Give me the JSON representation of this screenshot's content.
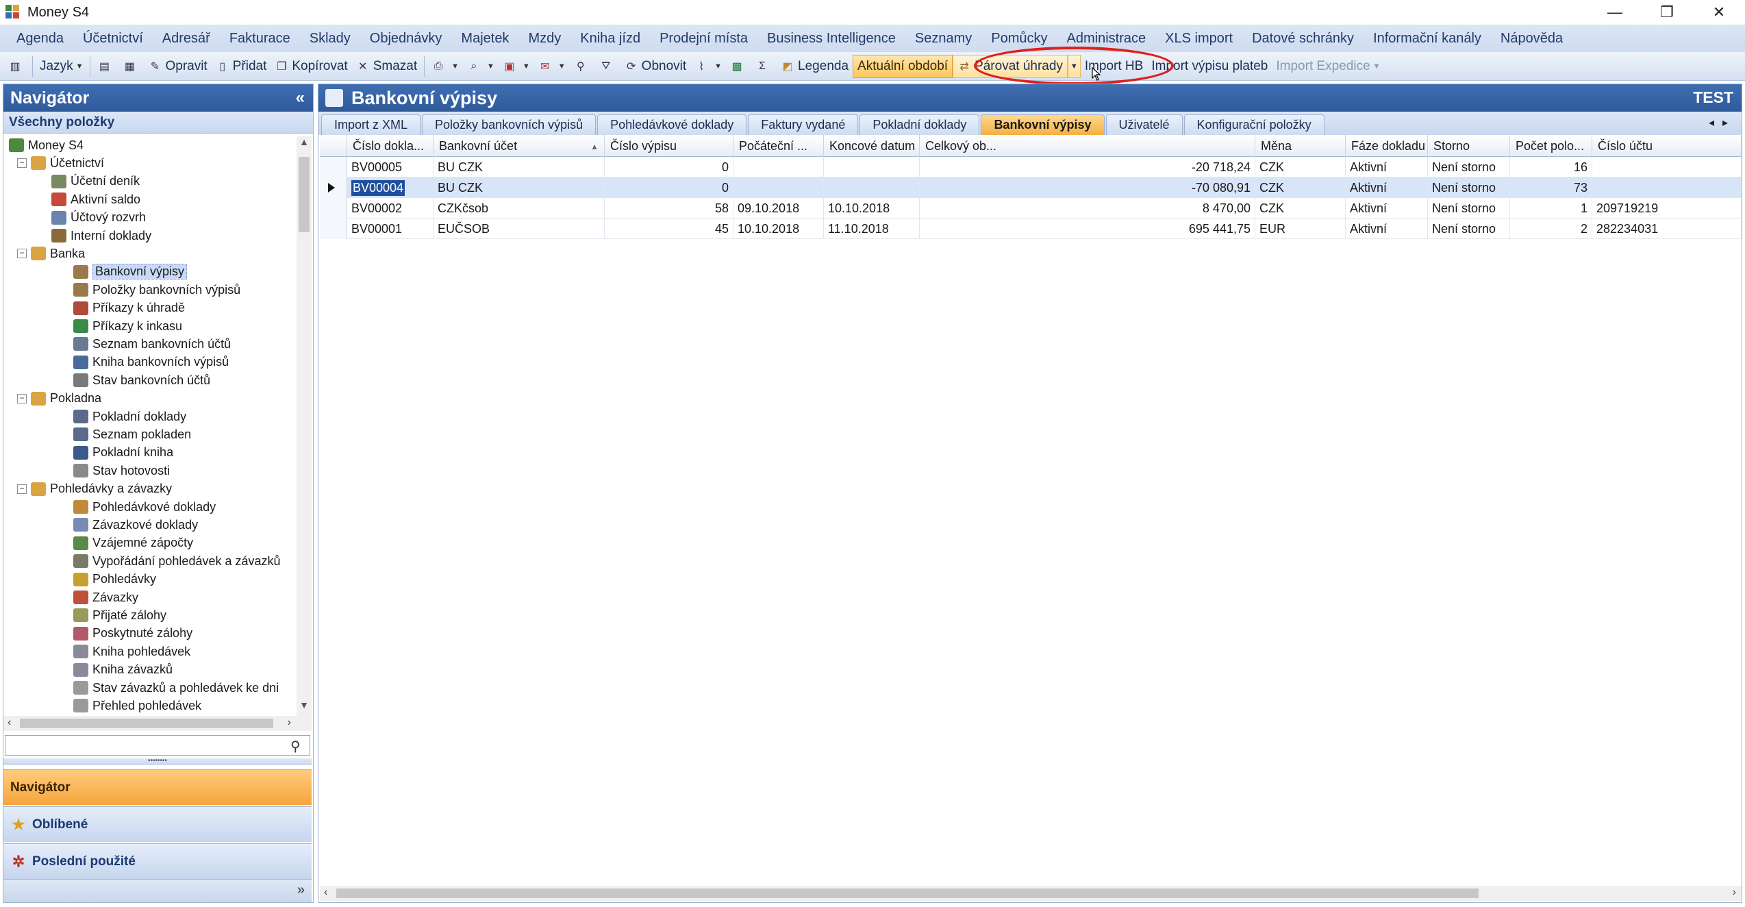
{
  "window": {
    "title": "Money S4",
    "controls": [
      "—",
      "❐",
      "✕"
    ]
  },
  "menu": [
    "Agenda",
    "Účetnictví",
    "Adresář",
    "Fakturace",
    "Sklady",
    "Objednávky",
    "Majetek",
    "Mzdy",
    "Kniha jízd",
    "Prodejní místa",
    "Business Intelligence",
    "Seznamy",
    "Pomůcky",
    "Administrace",
    "XLS import",
    "Datové schránky",
    "Informační kanály",
    "Nápověda"
  ],
  "toolbar": {
    "jazyk": "Jazyk",
    "opravit": "Opravit",
    "pridat": "Přidat",
    "kopirovat": "Kopírovat",
    "smazat": "Smazat",
    "obnovit": "Obnovit",
    "sigma": "Σ",
    "legenda": "Legenda",
    "aktualni_obdobi": "Aktuální období",
    "parovat_uhrady": "Párovat úhrady",
    "import_hb": "Import HB",
    "import_vypisu": "Import výpisu plateb",
    "import_expedice": "Import Expedice"
  },
  "navigator": {
    "title": "Navigátor",
    "collapse": "«",
    "section": "Všechny položky",
    "tree": [
      {
        "label": "Money S4",
        "level": 0,
        "icon": "#4a8a3a"
      },
      {
        "label": "Účetnictví",
        "level": 1,
        "toggle": "⊟",
        "icon": "#d9a441"
      },
      {
        "label": "Účetní deník",
        "level": 2,
        "icon": "#7a8a60"
      },
      {
        "label": "Aktivní saldo",
        "level": 2,
        "icon": "#c44a3a"
      },
      {
        "label": "Účtový rozvrh",
        "level": 2,
        "icon": "#6a84b0"
      },
      {
        "label": "Interní doklady",
        "level": 2,
        "icon": "#8a6a3a"
      },
      {
        "label": "Banka",
        "level": 1,
        "toggle": "⊟",
        "icon": "#d9a441"
      },
      {
        "label": "Bankovní výpisy",
        "level": 3,
        "icon": "#9a7a4a",
        "selected": true
      },
      {
        "label": "Položky bankovních výpisů",
        "level": 3,
        "icon": "#9a7a4a"
      },
      {
        "label": "Příkazy k úhradě",
        "level": 3,
        "icon": "#b04a3a"
      },
      {
        "label": "Příkazy k inkasu",
        "level": 3,
        "icon": "#3a8a4a"
      },
      {
        "label": "Seznam bankovních účtů",
        "level": 3,
        "icon": "#6a7a90"
      },
      {
        "label": "Kniha bankovních výpisů",
        "level": 3,
        "icon": "#4a6a9a"
      },
      {
        "label": "Stav bankovních účtů",
        "level": 3,
        "icon": "#7a7a7a"
      },
      {
        "label": "Pokladna",
        "level": 1,
        "toggle": "⊟",
        "icon": "#d9a441"
      },
      {
        "label": "Pokladní doklady",
        "level": 3,
        "icon": "#5a6a8a"
      },
      {
        "label": "Seznam pokladen",
        "level": 3,
        "icon": "#5a6a8a"
      },
      {
        "label": "Pokladní kniha",
        "level": 3,
        "icon": "#3a5a8a"
      },
      {
        "label": "Stav hotovosti",
        "level": 3,
        "icon": "#8a8a8a"
      },
      {
        "label": "Pohledávky a závazky",
        "level": 1,
        "toggle": "⊟",
        "icon": "#d9a441"
      },
      {
        "label": "Pohledávkové doklady",
        "level": 3,
        "icon": "#c08a3a"
      },
      {
        "label": "Závazkové doklady",
        "level": 3,
        "icon": "#7a8ab0"
      },
      {
        "label": "Vzájemné zápočty",
        "level": 3,
        "icon": "#5a8a4a"
      },
      {
        "label": "Vypořádání pohledávek a závazků",
        "level": 3,
        "icon": "#7a7a6a"
      },
      {
        "label": "Pohledávky",
        "level": 3,
        "icon": "#c8a030"
      },
      {
        "label": "Závazky",
        "level": 3,
        "icon": "#c0503a"
      },
      {
        "label": "Přijaté zálohy",
        "level": 3,
        "icon": "#9a9a5a"
      },
      {
        "label": "Poskytnuté zálohy",
        "level": 3,
        "icon": "#b05a6a"
      },
      {
        "label": "Kniha pohledávek",
        "level": 3,
        "icon": "#8a8a9a"
      },
      {
        "label": "Kniha závazků",
        "level": 3,
        "icon": "#8a8a9a"
      },
      {
        "label": "Stav závazků a pohledávek ke dni",
        "level": 3,
        "icon": "#9a9a9a"
      },
      {
        "label": "Přehled pohledávek",
        "level": 3,
        "icon": "#9a9a9a"
      }
    ],
    "buttons": {
      "navigator": "Navigátor",
      "favorites": "Oblíbené",
      "recent": "Poslední použité"
    },
    "footer_more": "»"
  },
  "main": {
    "title": "Bankovní výpisy",
    "env": "TEST",
    "tabs": [
      "Import z XML",
      "Položky bankovních výpisů",
      "Pohledávkové doklady",
      "Faktury vydané",
      "Pokladní doklady",
      "Bankovní výpisy",
      "Uživatelé",
      "Konfigurační položky"
    ],
    "active_tab": 5,
    "tab_arrows": "◂▸",
    "columns": [
      "Číslo dokla...",
      "Bankovní účet",
      "Číslo výpisu",
      "Počáteční ...",
      "Koncové datum",
      "Celkový ob...",
      "Měna",
      "Fáze dokladu",
      "Storno",
      "Počet polo...",
      "Číslo účtu"
    ],
    "rows": [
      [
        "BV00005",
        "BU CZK",
        "0",
        "",
        "",
        "-20 718,24",
        "CZK",
        "Aktivní",
        "Není storno",
        "16",
        ""
      ],
      [
        "BV00004",
        "BU CZK",
        "0",
        "",
        "",
        "-70 080,91",
        "CZK",
        "Aktivní",
        "Není storno",
        "73",
        ""
      ],
      [
        "BV00002",
        "CZKčsob",
        "58",
        "09.10.2018",
        "10.10.2018",
        "8 470,00",
        "CZK",
        "Aktivní",
        "Není storno",
        "1",
        "209719219"
      ],
      [
        "BV00001",
        "EUČSOB",
        "45",
        "10.10.2018",
        "11.10.2018",
        "695 441,75",
        "EUR",
        "Aktivní",
        "Není storno",
        "2",
        "282234031"
      ]
    ],
    "selected_row": 1
  },
  "colors": {
    "header_blue": "#2f5a9a",
    "active_orange": "#f6ae43",
    "highlight_red": "#e0201c"
  }
}
